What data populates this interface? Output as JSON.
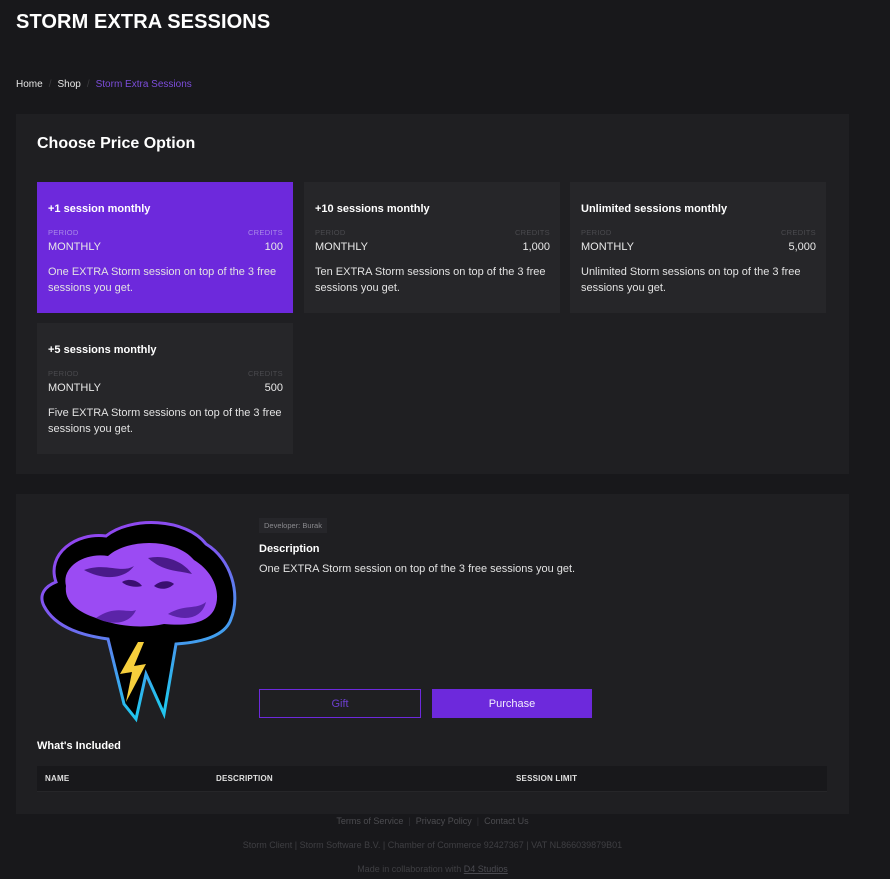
{
  "header": {
    "title": "STORM EXTRA SESSIONS"
  },
  "breadcrumb": {
    "items": [
      {
        "label": "Home"
      },
      {
        "label": "Shop"
      },
      {
        "label": "Storm Extra Sessions"
      }
    ],
    "separator": "/"
  },
  "price_section": {
    "title": "Choose Price Option",
    "period_label": "PERIOD",
    "credits_label": "CREDITS",
    "options": [
      {
        "title": "+1 session monthly",
        "period": "MONTHLY",
        "credits": "100",
        "description": "One EXTRA Storm session on top of the 3 free sessions you get.",
        "selected": true
      },
      {
        "title": "+10 sessions monthly",
        "period": "MONTHLY",
        "credits": "1,000",
        "description": "Ten EXTRA Storm sessions on top of the 3 free sessions you get.",
        "selected": false
      },
      {
        "title": "Unlimited sessions monthly",
        "period": "MONTHLY",
        "credits": "5,000",
        "description": "Unlimited Storm sessions on top of the 3 free sessions you get.",
        "selected": false
      },
      {
        "title": "+5 sessions monthly",
        "period": "MONTHLY",
        "credits": "500",
        "description": "Five EXTRA Storm sessions on top of the 3 free sessions you get.",
        "selected": false
      }
    ]
  },
  "product": {
    "logo_icon": "storm-cloud-lightning-logo",
    "developer_badge": "Developer: Burak",
    "description_title": "Description",
    "description_text": "One EXTRA Storm session on top of the 3 free sessions you get.",
    "gift_label": "Gift",
    "purchase_label": "Purchase"
  },
  "included": {
    "title": "What's Included",
    "columns": [
      "NAME",
      "DESCRIPTION",
      "SESSION LIMIT"
    ],
    "rows": []
  },
  "footer": {
    "links": [
      "Terms of Service",
      "Privacy Policy",
      "Contact Us"
    ],
    "legal": "Storm Client | Storm Software B.V. | Chamber of Commerce 92427367 | VAT NL866039879B01",
    "collab_prefix": "Made in collaboration with",
    "collab_link": "D4 Studios"
  },
  "colors": {
    "accent": "#6d29dc",
    "background": "#18181b",
    "panel": "#1f1f22",
    "card": "#262629"
  }
}
